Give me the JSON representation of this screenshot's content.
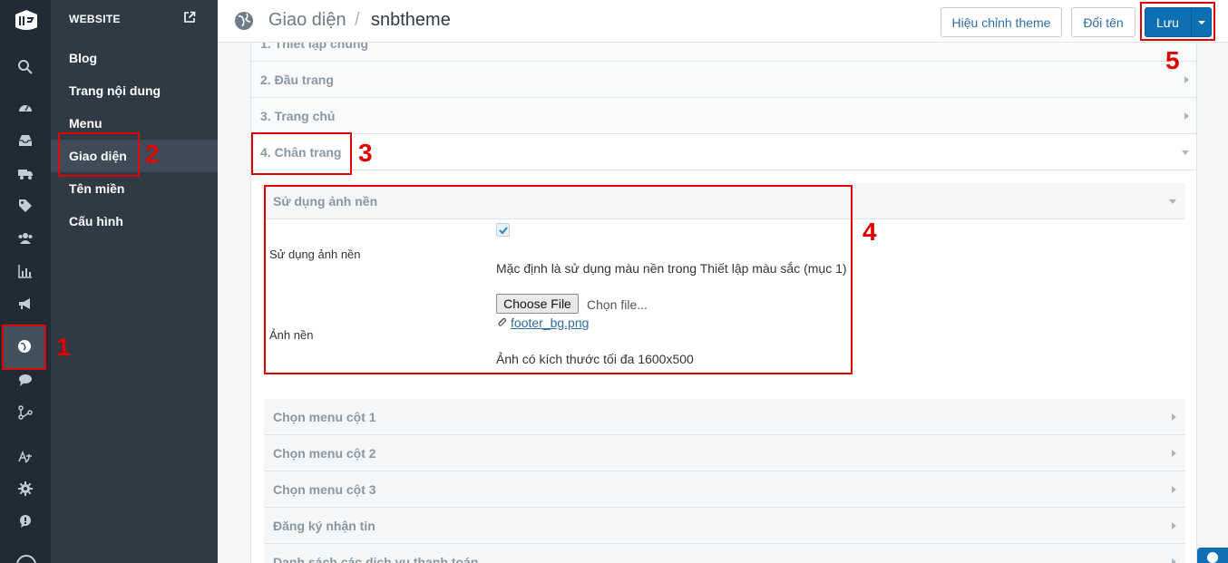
{
  "sidebar": {
    "header": "WEBSITE",
    "items": [
      {
        "label": "Blog"
      },
      {
        "label": "Trang nội dung"
      },
      {
        "label": "Menu"
      },
      {
        "label": "Giao diện"
      },
      {
        "label": "Tên miền"
      },
      {
        "label": "Cấu hình"
      }
    ],
    "active_item": "Giao diện"
  },
  "rail_icons": [
    "logo-icon",
    "search-icon",
    "dashboard-icon",
    "inbox-icon",
    "truck-icon",
    "tag-icon",
    "users-icon",
    "chart-icon",
    "megaphone-icon",
    "globe-icon",
    "chat-icon",
    "apps-icon",
    "translate-icon",
    "gear-icon",
    "feedback-icon"
  ],
  "header": {
    "breadcrumb_parent": "Giao diện",
    "breadcrumb_separator": "/",
    "breadcrumb_current": "snbtheme",
    "edit_theme_label": "Hiệu chỉnh theme",
    "rename_label": "Đổi tên",
    "save_label": "Lưu"
  },
  "sections": [
    {
      "title": "1. Thiết lập chung"
    },
    {
      "title": "2. Đầu trang"
    },
    {
      "title": "3. Trang chủ"
    },
    {
      "title": "4. Chân trang",
      "expanded": true
    }
  ],
  "footer_section": {
    "background_group": {
      "title": "Sử dụng ảnh nền",
      "use_background_label": "Sử dụng ảnh nền",
      "use_background_checked": true,
      "use_background_help": "Mặc định là sử dụng màu nền trong Thiết lập màu sắc (mục 1)",
      "image_label": "Ảnh nền",
      "choose_file_label": "Choose File",
      "file_status": "Chọn file...",
      "current_file": "footer_bg.png",
      "image_help": "Ảnh có kích thước tối đa 1600x500"
    },
    "subsections": [
      {
        "title": "Chọn menu cột 1"
      },
      {
        "title": "Chọn menu cột 2"
      },
      {
        "title": "Chọn menu cột 3"
      },
      {
        "title": "Đăng ký nhận tin"
      },
      {
        "title": "Danh sách các dịch vụ thanh toán"
      }
    ]
  },
  "annotations": [
    "1",
    "2",
    "3",
    "4",
    "5"
  ],
  "colors": {
    "annotation": "#e00000",
    "primary": "#0e6fb2",
    "rail": "#212b35",
    "sidebar": "#2f3a45"
  }
}
